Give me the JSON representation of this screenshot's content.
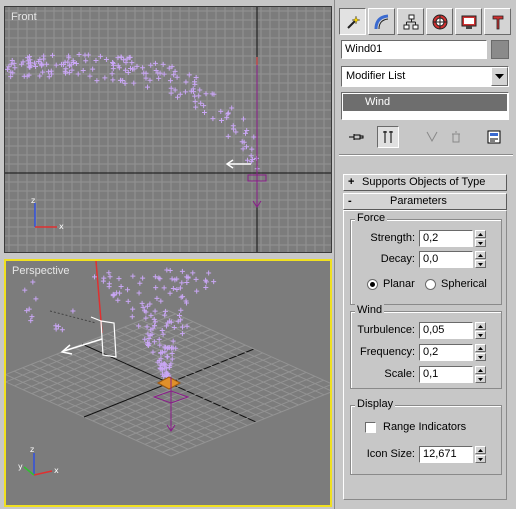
{
  "viewports": {
    "front_label": "Front",
    "perspective_label": "Perspective"
  },
  "command_panel": {
    "tabs": [
      "create-tab",
      "modify-tab",
      "hierarchy-tab",
      "motion-tab",
      "display-tab",
      "utilities-tab"
    ],
    "active_tab": "create-tab",
    "object_name": "Wind01",
    "modifier_list": "Modifier List",
    "stack_items": [
      "Wind"
    ],
    "rollouts": {
      "supports_objects": {
        "sign": "+",
        "title": "Supports Objects of Type"
      },
      "parameters": {
        "sign": "-",
        "title": "Parameters"
      }
    },
    "force": {
      "title": "Force",
      "strength_label": "Strength:",
      "strength_value": "0,2",
      "decay_label": "Decay:",
      "decay_value": "0,0",
      "planar_label": "Planar",
      "spherical_label": "Spherical",
      "selected": "Planar"
    },
    "wind": {
      "title": "Wind",
      "turbulence_label": "Turbulence:",
      "turbulence_value": "0,05",
      "frequency_label": "Frequency:",
      "frequency_value": "0,2",
      "scale_label": "Scale:",
      "scale_value": "0,1"
    },
    "display": {
      "title": "Display",
      "range_indicators_label": "Range Indicators",
      "range_indicators_checked": false,
      "icon_size_label": "Icon Size:",
      "icon_size_value": "12,671"
    }
  },
  "colors": {
    "viewport_bg": "#7c7c7c",
    "grid": "#939393",
    "particles": "#c9a6f5",
    "active_viewport_border": "#f0e020",
    "wind_gizmo": "#8a1c8a",
    "axis_x": "#e03030",
    "axis_y": "#30c030",
    "axis_z": "#3050e0"
  }
}
